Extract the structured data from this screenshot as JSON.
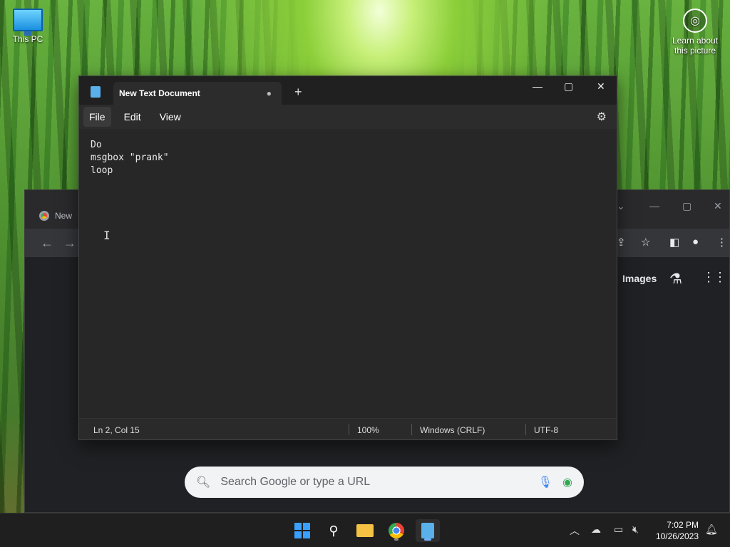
{
  "desktop": {
    "icons": [
      {
        "label": "This PC"
      }
    ],
    "learn": {
      "label_line1": "Learn about",
      "label_line2": "this picture"
    }
  },
  "chrome": {
    "tab_label": "New",
    "search_placeholder": "Search Google or type a URL",
    "images_link": "Images"
  },
  "notepad": {
    "tab_title": "New Text Document",
    "menu": [
      "File",
      "Edit",
      "View"
    ],
    "content_lines": [
      "Do",
      "msgbox \"prank\"",
      "loop"
    ],
    "status": {
      "position": "Ln 2, Col 15",
      "zoom": "100%",
      "line_ending": "Windows (CRLF)",
      "encoding": "UTF-8"
    }
  },
  "taskbar": {
    "time": "7:02 PM",
    "date": "10/26/2023"
  },
  "colors": {
    "accent": "#3aa0ff",
    "notepad_bg": "#272727",
    "taskbar_bg": "#1f1f1f"
  }
}
